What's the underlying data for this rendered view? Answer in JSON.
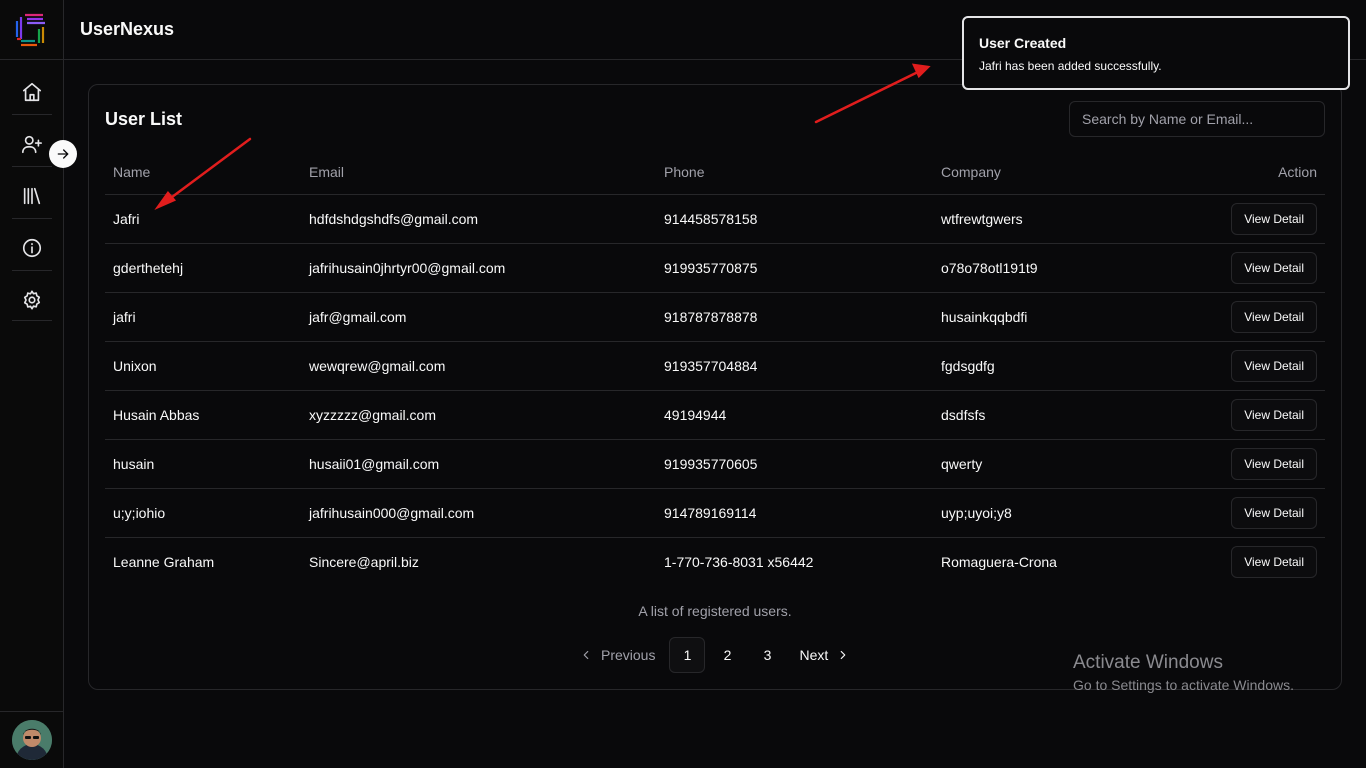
{
  "app": {
    "title": "UserNexus"
  },
  "sidebar": {
    "items": [
      {
        "icon": "home-icon"
      },
      {
        "icon": "user-plus-icon"
      },
      {
        "icon": "library-icon"
      },
      {
        "icon": "info-icon"
      },
      {
        "icon": "settings-icon"
      }
    ],
    "expand_icon": "arrow-right-icon"
  },
  "card": {
    "title": "User List",
    "search_placeholder": "Search by Name or Email...",
    "columns": [
      "Name",
      "Email",
      "Phone",
      "Company",
      "Action"
    ],
    "rows": [
      {
        "name": "Jafri",
        "email": "hdfdshdgshdfs@gmail.com",
        "phone": "914458578158",
        "company": "wtfrewtgwers",
        "action": "View Detail"
      },
      {
        "name": "gderthetehj",
        "email": "jafrihusain0jhrtyr00@gmail.com",
        "phone": "919935770875",
        "company": "o78o78otl191t9",
        "action": "View Detail"
      },
      {
        "name": "jafri",
        "email": "jafr@gmail.com",
        "phone": "918787878878",
        "company": "husainkqqbdfi",
        "action": "View Detail"
      },
      {
        "name": "Unixon",
        "email": "wewqrew@gmail.com",
        "phone": "919357704884",
        "company": "fgdsgdfg",
        "action": "View Detail"
      },
      {
        "name": "Husain Abbas",
        "email": "xyzzzzz@gmail.com",
        "phone": "49194944",
        "company": "dsdfsfs",
        "action": "View Detail"
      },
      {
        "name": "husain",
        "email": "husaii01@gmail.com",
        "phone": "919935770605",
        "company": "qwerty",
        "action": "View Detail"
      },
      {
        "name": "u;y;iohio",
        "email": "jafrihusain000@gmail.com",
        "phone": "914789169114",
        "company": "uyp;uyoi;y8",
        "action": "View Detail"
      },
      {
        "name": "Leanne Graham",
        "email": "Sincere@april.biz",
        "phone": "1-770-736-8031 x56442",
        "company": "Romaguera-Crona",
        "action": "View Detail"
      }
    ],
    "caption": "A list of registered users.",
    "pagination": {
      "previous": "Previous",
      "pages": [
        "1",
        "2",
        "3"
      ],
      "current": "1",
      "next": "Next"
    }
  },
  "toast": {
    "title": "User Created",
    "description": "Jafri has been added successfully."
  },
  "watermark": {
    "line1": "Activate Windows",
    "line2": "Go to Settings to activate Windows."
  },
  "colors": {
    "background": "#09090b",
    "border": "#27272a",
    "muted_text": "#a1a1aa",
    "annotation_arrow": "#e11d1d"
  }
}
